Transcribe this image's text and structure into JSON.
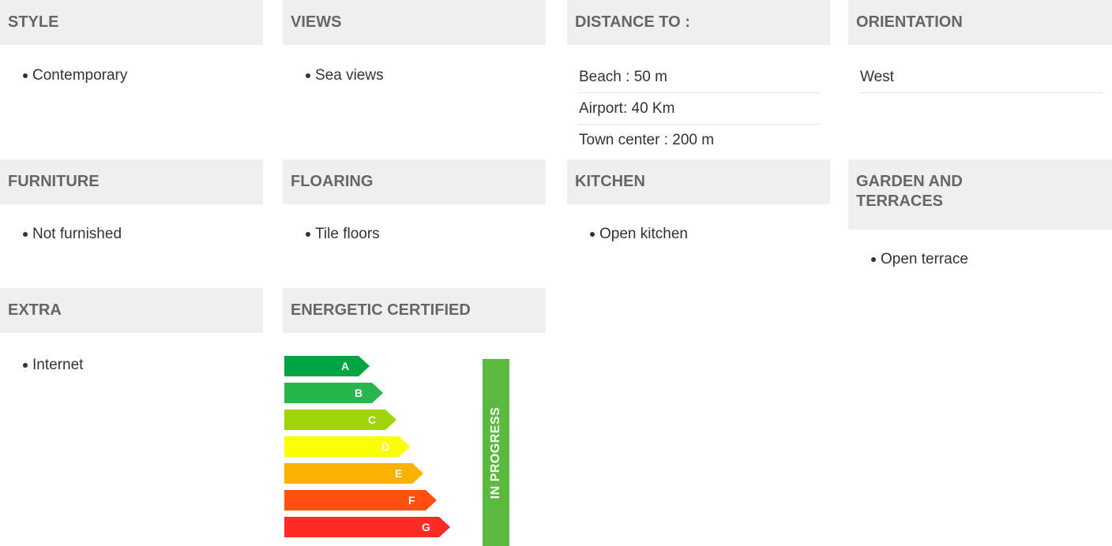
{
  "sections": {
    "style": {
      "title": "STYLE",
      "items": [
        "Contemporary"
      ]
    },
    "views": {
      "title": "VIEWS",
      "items": [
        "Sea views"
      ]
    },
    "distance": {
      "title": "DISTANCE TO :",
      "rows": [
        "Beach : 50 m",
        "Airport: 40 Km",
        "Town center : 200 m"
      ]
    },
    "orientation": {
      "title": "ORIENTATION",
      "rows": [
        "West"
      ]
    },
    "furniture": {
      "title": "FURNITURE",
      "items": [
        "Not furnished"
      ]
    },
    "flooring": {
      "title": "FLOARING",
      "items": [
        "Tile floors"
      ]
    },
    "kitchen": {
      "title": "KITCHEN",
      "items": [
        "Open kitchen"
      ]
    },
    "garden": {
      "title": "GARDEN AND TERRACES",
      "items": [
        "Open terrace"
      ]
    },
    "extra": {
      "title": "EXTRA",
      "items": [
        "Internet"
      ]
    },
    "energy": {
      "title": "ENERGETIC CERTIFIED",
      "status": "IN PROGRESS",
      "status_color": "#5cb93f",
      "classes": [
        {
          "letter": "A",
          "color": "#00a443"
        },
        {
          "letter": "B",
          "color": "#27b64c"
        },
        {
          "letter": "C",
          "color": "#9fd40b"
        },
        {
          "letter": "D",
          "color": "#fcff00"
        },
        {
          "letter": "E",
          "color": "#fbb100"
        },
        {
          "letter": "F",
          "color": "#ff5010"
        },
        {
          "letter": "G",
          "color": "#fe2a26"
        }
      ]
    }
  }
}
